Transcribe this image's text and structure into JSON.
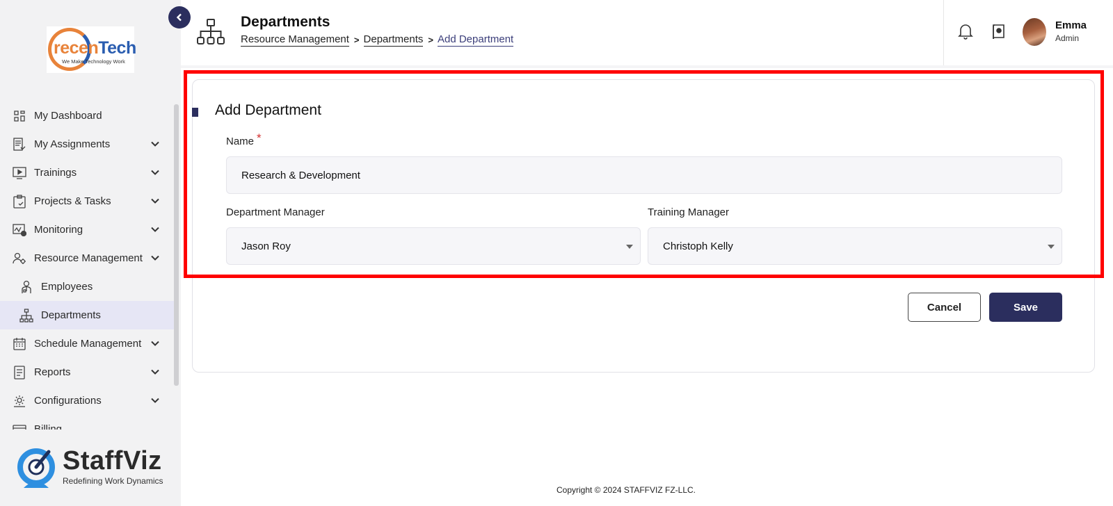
{
  "sidebar": {
    "logo": {
      "brand_part1": "recen",
      "brand_part2": "Tech",
      "tagline": "We Make Technology Work"
    },
    "items": [
      {
        "label": "My Dashboard",
        "icon": "dashboard-icon",
        "expandable": false
      },
      {
        "label": "My Assignments",
        "icon": "assignments-icon",
        "expandable": true
      },
      {
        "label": "Trainings",
        "icon": "play-icon",
        "expandable": true
      },
      {
        "label": "Projects & Tasks",
        "icon": "clipboard-icon",
        "expandable": true
      },
      {
        "label": "Monitoring",
        "icon": "monitoring-icon",
        "expandable": true
      },
      {
        "label": "Resource Management",
        "icon": "resource-icon",
        "expandable": true
      },
      {
        "label": "Employees",
        "icon": "employee-icon",
        "sub": true
      },
      {
        "label": "Departments",
        "icon": "org-chart-icon",
        "sub": true,
        "active": true
      },
      {
        "label": "Schedule Management",
        "icon": "calendar-icon",
        "expandable": true
      },
      {
        "label": "Reports",
        "icon": "report-icon",
        "expandable": true
      },
      {
        "label": "Configurations",
        "icon": "gear-icon",
        "expandable": true
      },
      {
        "label": "Billing",
        "icon": "billing-icon",
        "expandable": false
      }
    ],
    "footer_logo": {
      "title": "StaffViz",
      "tagline": "Redefining Work Dynamics"
    }
  },
  "header": {
    "title": "Departments",
    "breadcrumb": [
      "Resource Management",
      "Departments",
      "Add Department"
    ],
    "user": {
      "name": "Emma",
      "role": "Admin"
    }
  },
  "form": {
    "title": "Add Department",
    "name_label": "Name",
    "name_required_mark": "*",
    "name_value": "Research & Development",
    "dept_manager_label": "Department Manager",
    "dept_manager_value": "Jason Roy",
    "training_manager_label": "Training Manager",
    "training_manager_value": "Christoph Kelly",
    "cancel_label": "Cancel",
    "save_label": "Save"
  },
  "footer": {
    "copyright": "Copyright © 2024 STAFFVIZ FZ-LLC."
  },
  "colors": {
    "primary": "#2b2e5e",
    "highlight": "#ff0000",
    "active_bg": "#e6e6f5"
  }
}
